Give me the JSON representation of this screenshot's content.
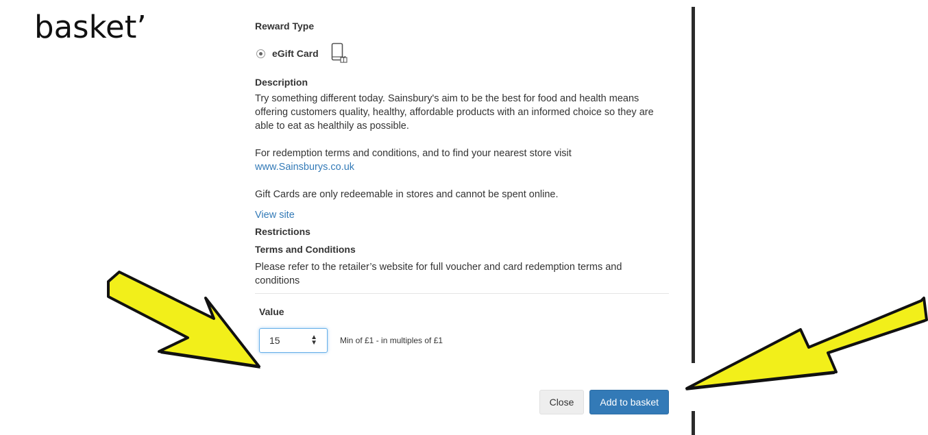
{
  "slide": {
    "text": "basket’"
  },
  "reward_type": {
    "heading": "Reward Type",
    "option_label": "eGift Card",
    "option_icon": "phone-gift-icon"
  },
  "description": {
    "heading": "Description",
    "text": "Try something different today. Sainsbury's aim to be the best for food and health means offering customers quality, healthy, affordable products with an informed choice so they are able to eat as healthily as possible.",
    "redeem_text": "For redemption terms and conditions, and to find your nearest store visit",
    "redeem_link": "www.Sainsburys.co.uk",
    "gift_note": "Gift Cards are only redeemable in stores and cannot be spent online.",
    "view_site": "View site"
  },
  "restrictions": {
    "heading": "Restrictions"
  },
  "terms": {
    "heading": "Terms and Conditions",
    "text": "Please refer to the retailer’s website for full voucher and card redemption terms and conditions"
  },
  "value": {
    "heading": "Value",
    "input_value": "15",
    "hint": "Min of £1 - in multiples of £1"
  },
  "buttons": {
    "close": "Close",
    "add": "Add to basket"
  },
  "colors": {
    "link": "#337ab7",
    "primary_button": "#337ab7",
    "arrow_fill": "#f2ef1a",
    "arrow_outline": "#111111"
  }
}
